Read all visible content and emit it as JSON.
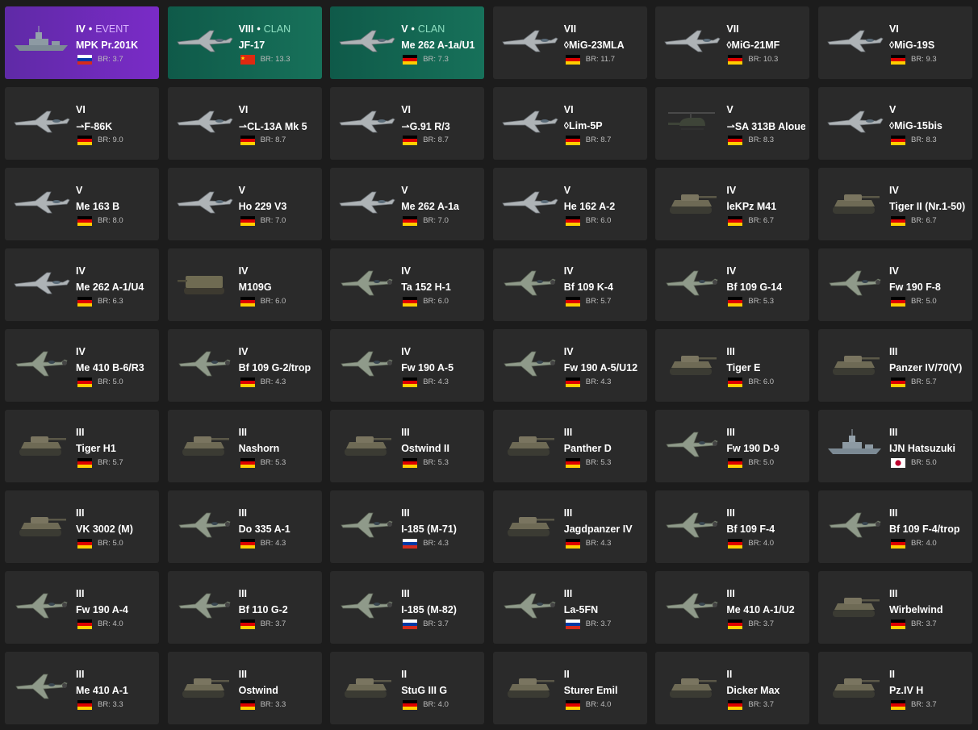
{
  "ui": {
    "br_prefix": "BR: "
  },
  "vehicles": [
    {
      "rank": "IV",
      "tag": "EVENT",
      "style": "event",
      "icon": "ship-icon",
      "name": "MPK Pr.201K",
      "flag": "ussr",
      "br": "3.7"
    },
    {
      "rank": "VIII",
      "tag": "CLAN",
      "style": "clan",
      "icon": "jet-icon",
      "name": "JF-17",
      "flag": "china",
      "br": "13.3"
    },
    {
      "rank": "V",
      "tag": "CLAN",
      "style": "clan",
      "icon": "jet-icon",
      "name": "Me 262 A-1a/U1",
      "flag": "germany",
      "br": "7.3"
    },
    {
      "rank": "VII",
      "tag": "",
      "style": "normal",
      "icon": "jet-icon",
      "name": "◊MiG-23MLA",
      "flag": "germany",
      "br": "11.7"
    },
    {
      "rank": "VII",
      "tag": "",
      "style": "normal",
      "icon": "jet-icon",
      "name": "◊MiG-21MF",
      "flag": "germany",
      "br": "10.3"
    },
    {
      "rank": "VI",
      "tag": "",
      "style": "normal",
      "icon": "jet-icon",
      "name": "◊MiG-19S",
      "flag": "germany",
      "br": "9.3"
    },
    {
      "rank": "VI",
      "tag": "",
      "style": "normal",
      "icon": "jet-icon",
      "name": "⇀F-86K",
      "flag": "germany",
      "br": "9.0"
    },
    {
      "rank": "VI",
      "tag": "",
      "style": "normal",
      "icon": "jet-icon",
      "name": "⇀CL-13A Mk 5",
      "flag": "germany",
      "br": "8.7"
    },
    {
      "rank": "VI",
      "tag": "",
      "style": "normal",
      "icon": "jet-icon",
      "name": "⇀G.91 R/3",
      "flag": "germany",
      "br": "8.7"
    },
    {
      "rank": "VI",
      "tag": "",
      "style": "normal",
      "icon": "jet-icon",
      "name": "◊Lim-5P",
      "flag": "germany",
      "br": "8.7"
    },
    {
      "rank": "V",
      "tag": "",
      "style": "normal",
      "icon": "helicopter-icon",
      "name": "⇀SA 313B Alouette",
      "flag": "germany",
      "br": "8.3"
    },
    {
      "rank": "V",
      "tag": "",
      "style": "normal",
      "icon": "jet-icon",
      "name": "◊MiG-15bis",
      "flag": "germany",
      "br": "8.3"
    },
    {
      "rank": "V",
      "tag": "",
      "style": "normal",
      "icon": "jet-icon",
      "name": "Me 163 B",
      "flag": "germany",
      "br": "8.0"
    },
    {
      "rank": "V",
      "tag": "",
      "style": "normal",
      "icon": "jet-icon",
      "name": "Ho 229 V3",
      "flag": "germany",
      "br": "7.0"
    },
    {
      "rank": "V",
      "tag": "",
      "style": "normal",
      "icon": "jet-icon",
      "name": "Me 262 A-1a",
      "flag": "germany",
      "br": "7.0"
    },
    {
      "rank": "V",
      "tag": "",
      "style": "normal",
      "icon": "jet-icon",
      "name": "He 162 A-2",
      "flag": "germany",
      "br": "6.0"
    },
    {
      "rank": "IV",
      "tag": "",
      "style": "normal",
      "icon": "tank-icon",
      "name": "leKPz M41",
      "flag": "germany",
      "br": "6.7"
    },
    {
      "rank": "IV",
      "tag": "",
      "style": "normal",
      "icon": "tank-icon",
      "name": "Tiger II (Nr.1-50)",
      "flag": "germany",
      "br": "6.7"
    },
    {
      "rank": "IV",
      "tag": "",
      "style": "normal",
      "icon": "jet-icon",
      "name": "Me 262 A-1/U4",
      "flag": "germany",
      "br": "6.3"
    },
    {
      "rank": "IV",
      "tag": "",
      "style": "normal",
      "icon": "artillery-icon",
      "name": "M109G",
      "flag": "germany",
      "br": "6.0"
    },
    {
      "rank": "IV",
      "tag": "",
      "style": "normal",
      "icon": "plane-icon",
      "name": "Ta 152 H-1",
      "flag": "germany",
      "br": "6.0"
    },
    {
      "rank": "IV",
      "tag": "",
      "style": "normal",
      "icon": "plane-icon",
      "name": "Bf 109 K-4",
      "flag": "germany",
      "br": "5.7"
    },
    {
      "rank": "IV",
      "tag": "",
      "style": "normal",
      "icon": "plane-icon",
      "name": "Bf 109 G-14",
      "flag": "germany",
      "br": "5.3"
    },
    {
      "rank": "IV",
      "tag": "",
      "style": "normal",
      "icon": "plane-icon",
      "name": "Fw 190 F-8",
      "flag": "germany",
      "br": "5.0"
    },
    {
      "rank": "IV",
      "tag": "",
      "style": "normal",
      "icon": "plane-icon",
      "name": "Me 410 B-6/R3",
      "flag": "germany",
      "br": "5.0"
    },
    {
      "rank": "IV",
      "tag": "",
      "style": "normal",
      "icon": "plane-icon",
      "name": "Bf 109 G-2/trop",
      "flag": "germany",
      "br": "4.3"
    },
    {
      "rank": "IV",
      "tag": "",
      "style": "normal",
      "icon": "plane-icon",
      "name": "Fw 190 A-5",
      "flag": "germany",
      "br": "4.3"
    },
    {
      "rank": "IV",
      "tag": "",
      "style": "normal",
      "icon": "plane-icon",
      "name": "Fw 190 A-5/U12",
      "flag": "germany",
      "br": "4.3"
    },
    {
      "rank": "III",
      "tag": "",
      "style": "normal",
      "icon": "tank-icon",
      "name": "Tiger E",
      "flag": "germany",
      "br": "6.0"
    },
    {
      "rank": "III",
      "tag": "",
      "style": "normal",
      "icon": "tank-icon",
      "name": "Panzer IV/70(V)",
      "flag": "germany",
      "br": "5.7"
    },
    {
      "rank": "III",
      "tag": "",
      "style": "normal",
      "icon": "tank-icon",
      "name": "Tiger H1",
      "flag": "germany",
      "br": "5.7"
    },
    {
      "rank": "III",
      "tag": "",
      "style": "normal",
      "icon": "tank-icon",
      "name": "Nashorn",
      "flag": "germany",
      "br": "5.3"
    },
    {
      "rank": "III",
      "tag": "",
      "style": "normal",
      "icon": "tank-icon",
      "name": "Ostwind II",
      "flag": "germany",
      "br": "5.3"
    },
    {
      "rank": "III",
      "tag": "",
      "style": "normal",
      "icon": "tank-icon",
      "name": "Panther D",
      "flag": "germany",
      "br": "5.3"
    },
    {
      "rank": "III",
      "tag": "",
      "style": "normal",
      "icon": "plane-icon",
      "name": "Fw 190 D-9",
      "flag": "germany",
      "br": "5.0"
    },
    {
      "rank": "III",
      "tag": "",
      "style": "normal",
      "icon": "ship-icon",
      "name": "IJN Hatsuzuki",
      "flag": "japan",
      "br": "5.0"
    },
    {
      "rank": "III",
      "tag": "",
      "style": "normal",
      "icon": "tank-icon",
      "name": "VK 3002 (M)",
      "flag": "germany",
      "br": "5.0"
    },
    {
      "rank": "III",
      "tag": "",
      "style": "normal",
      "icon": "plane-icon",
      "name": "Do 335 A-1",
      "flag": "germany",
      "br": "4.3"
    },
    {
      "rank": "III",
      "tag": "",
      "style": "normal",
      "icon": "plane-icon",
      "name": "I-185 (M-71)",
      "flag": "ussr",
      "br": "4.3"
    },
    {
      "rank": "III",
      "tag": "",
      "style": "normal",
      "icon": "tank-icon",
      "name": "Jagdpanzer IV",
      "flag": "germany",
      "br": "4.3"
    },
    {
      "rank": "III",
      "tag": "",
      "style": "normal",
      "icon": "plane-icon",
      "name": "Bf 109 F-4",
      "flag": "germany",
      "br": "4.0"
    },
    {
      "rank": "III",
      "tag": "",
      "style": "normal",
      "icon": "plane-icon",
      "name": "Bf 109 F-4/trop",
      "flag": "germany",
      "br": "4.0"
    },
    {
      "rank": "III",
      "tag": "",
      "style": "normal",
      "icon": "plane-icon",
      "name": "Fw 190 A-4",
      "flag": "germany",
      "br": "4.0"
    },
    {
      "rank": "III",
      "tag": "",
      "style": "normal",
      "icon": "plane-icon",
      "name": "Bf 110 G-2",
      "flag": "germany",
      "br": "3.7"
    },
    {
      "rank": "III",
      "tag": "",
      "style": "normal",
      "icon": "plane-icon",
      "name": "I-185 (M-82)",
      "flag": "ussr",
      "br": "3.7"
    },
    {
      "rank": "III",
      "tag": "",
      "style": "normal",
      "icon": "plane-icon",
      "name": "La-5FN",
      "flag": "ussr",
      "br": "3.7"
    },
    {
      "rank": "III",
      "tag": "",
      "style": "normal",
      "icon": "plane-icon",
      "name": "Me 410 A-1/U2",
      "flag": "germany",
      "br": "3.7"
    },
    {
      "rank": "III",
      "tag": "",
      "style": "normal",
      "icon": "tank-icon",
      "name": "Wirbelwind",
      "flag": "germany",
      "br": "3.7"
    },
    {
      "rank": "III",
      "tag": "",
      "style": "normal",
      "icon": "plane-icon",
      "name": "Me 410 A-1",
      "flag": "germany",
      "br": "3.3"
    },
    {
      "rank": "III",
      "tag": "",
      "style": "normal",
      "icon": "tank-icon",
      "name": "Ostwind",
      "flag": "germany",
      "br": "3.3"
    },
    {
      "rank": "II",
      "tag": "",
      "style": "normal",
      "icon": "tank-icon",
      "name": "StuG III G",
      "flag": "germany",
      "br": "4.0"
    },
    {
      "rank": "II",
      "tag": "",
      "style": "normal",
      "icon": "tank-icon",
      "name": "Sturer Emil",
      "flag": "germany",
      "br": "4.0"
    },
    {
      "rank": "II",
      "tag": "",
      "style": "normal",
      "icon": "tank-icon",
      "name": "Dicker Max",
      "flag": "germany",
      "br": "3.7"
    },
    {
      "rank": "II",
      "tag": "",
      "style": "normal",
      "icon": "tank-icon",
      "name": "Pz.IV H",
      "flag": "germany",
      "br": "3.7"
    }
  ]
}
